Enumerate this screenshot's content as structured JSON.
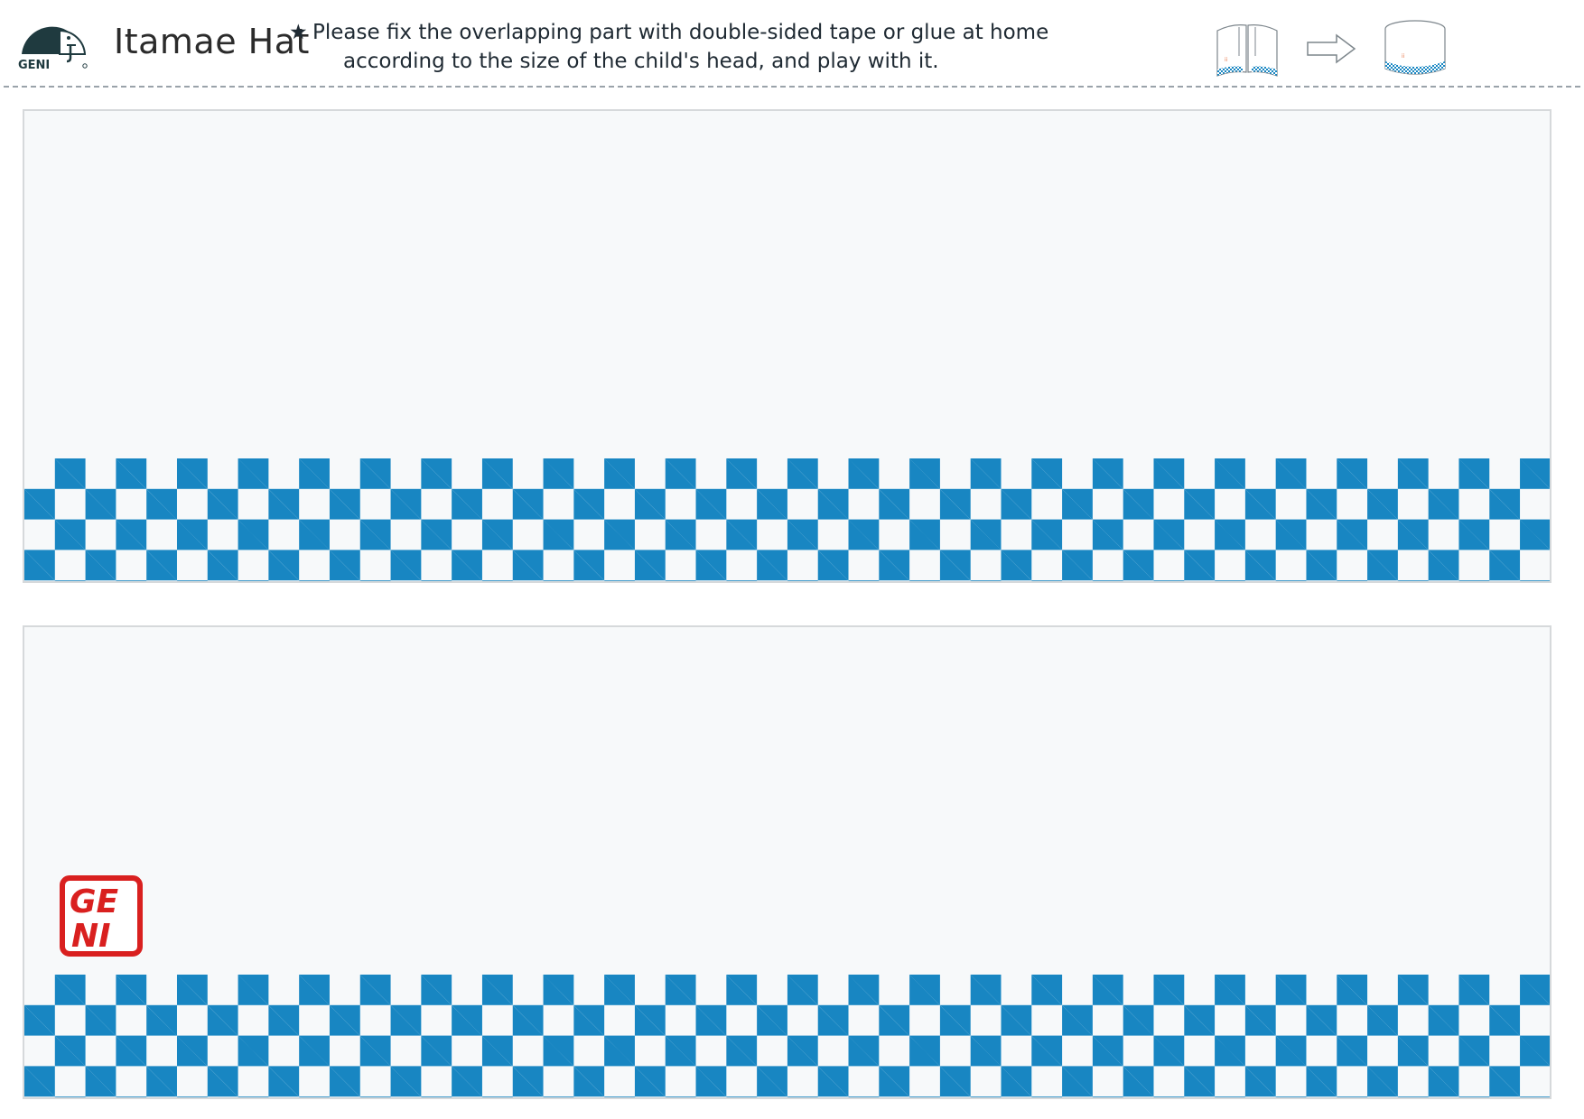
{
  "header": {
    "logo_text": "GENI",
    "title": "Itamae Hat",
    "star": "★",
    "instruction_line1": "Please fix the overlapping part with double-sided tape or glue at home",
    "instruction_line2": "according to the size of the child's head, and play with it."
  },
  "diagram": {
    "before_icon": "open-band-icon",
    "arrow_icon": "right-arrow-icon",
    "after_icon": "closed-band-icon"
  },
  "strips": [
    {
      "pattern": "ichimatsu-checker",
      "color": "#1886c2"
    },
    {
      "pattern": "ichimatsu-checker",
      "color": "#1886c2",
      "stamp_text": "GENI"
    }
  ],
  "colors": {
    "checker_blue": "#1886c2",
    "stamp_red": "#d9201f",
    "logo_dark": "#1f3a3f"
  }
}
